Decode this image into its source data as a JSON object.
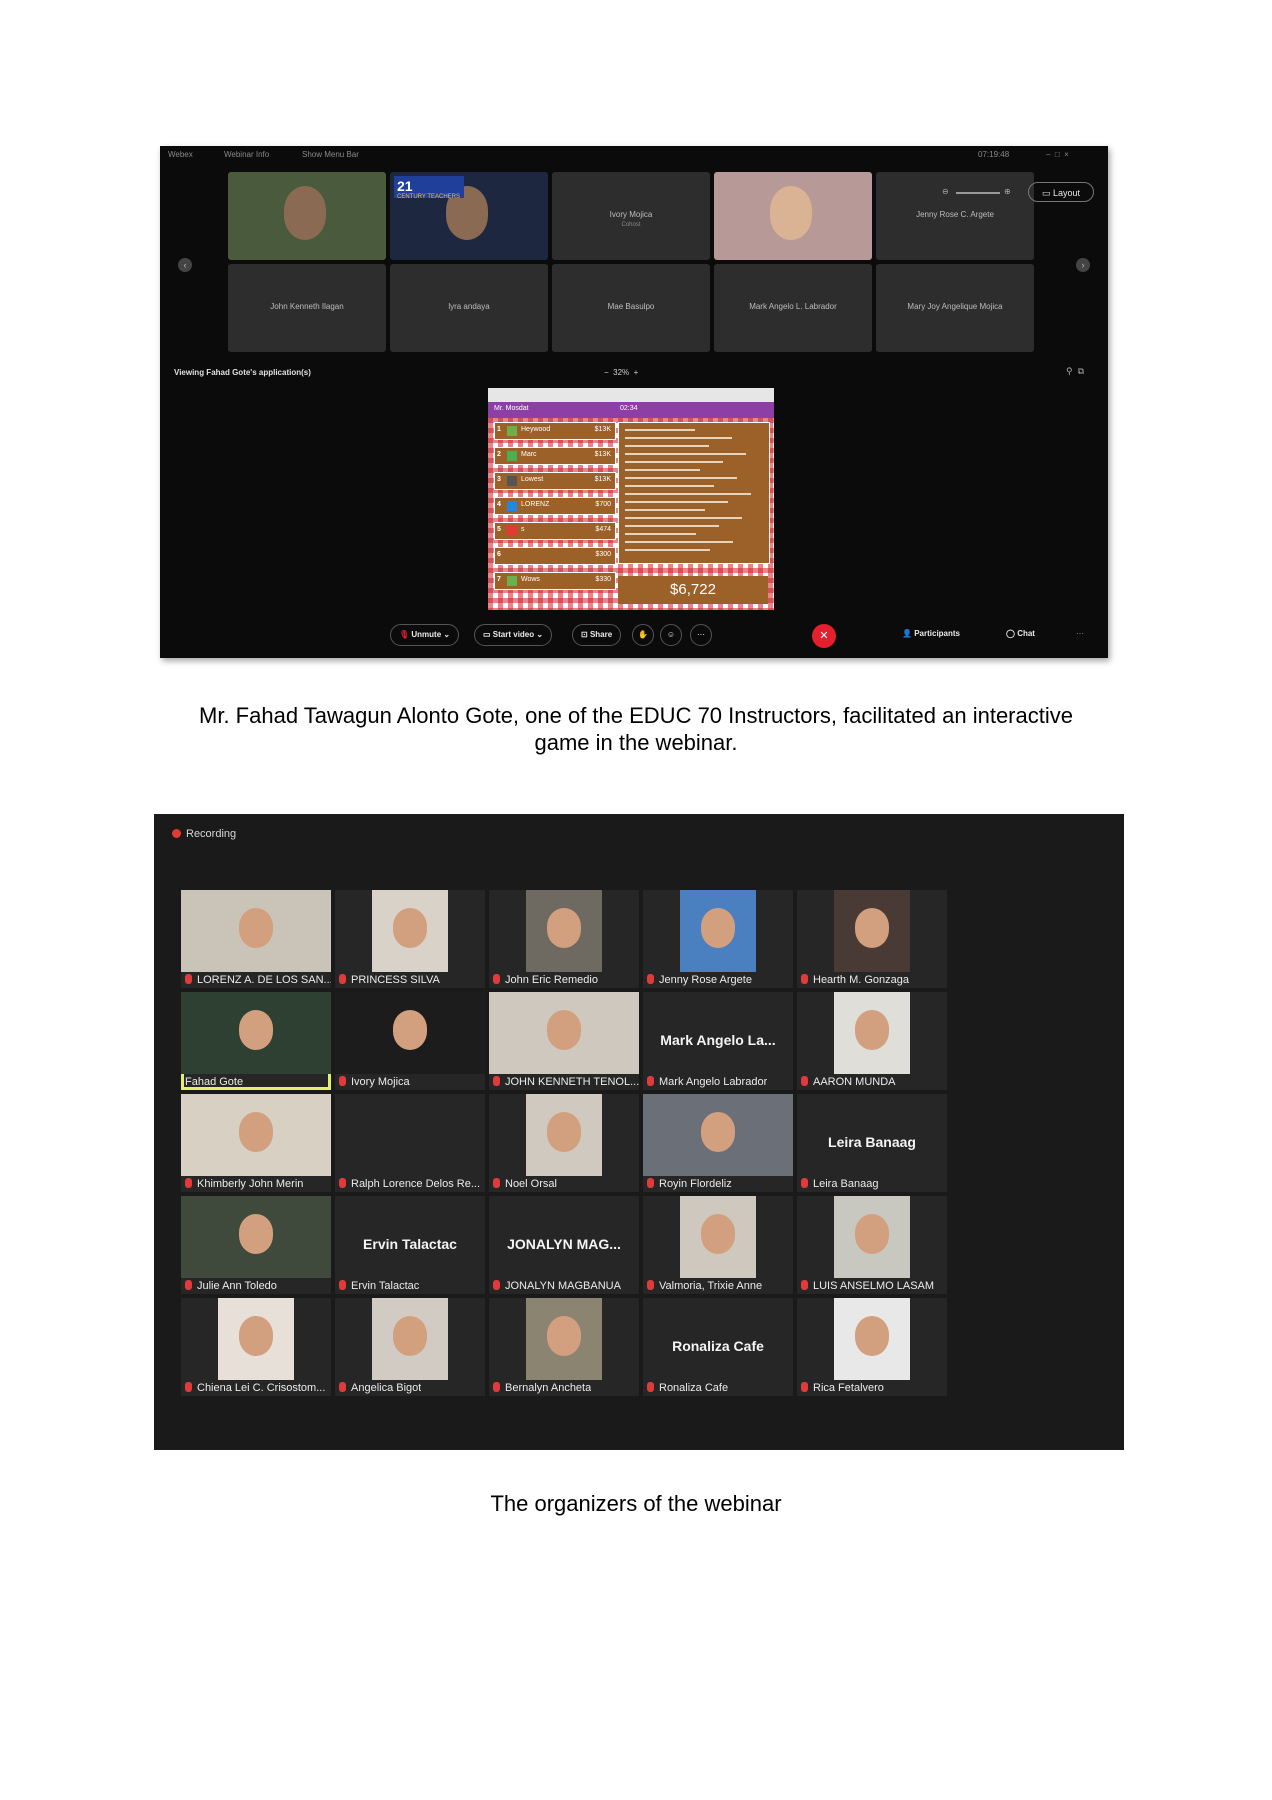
{
  "shot1": {
    "topbar": {
      "left_items": [
        "Webex",
        "Webinar Info",
        "Show Menu Bar"
      ],
      "time": "07:19:48"
    },
    "tiles": [
      {
        "kind": "video"
      },
      {
        "kind": "video-banner",
        "banner_num": "21",
        "banner_text": "CENTURY TEACHERS"
      },
      {
        "kind": "name",
        "name": "Ivory Mojica",
        "sub": "Cohost"
      },
      {
        "kind": "video"
      },
      {
        "kind": "name",
        "name": "Jenny Rose C. Argete",
        "sub": ""
      },
      {
        "kind": "name",
        "name": "John Kenneth Ilagan",
        "sub": ""
      },
      {
        "kind": "name",
        "name": "lyra andaya",
        "sub": ""
      },
      {
        "kind": "name",
        "name": "Mae Basulpo",
        "sub": ""
      },
      {
        "kind": "name",
        "name": "Mark Angelo L. Labrador",
        "sub": ""
      },
      {
        "kind": "name",
        "name": "Mary Joy Angelique Mojica",
        "sub": ""
      }
    ],
    "layout_label": "Layout",
    "viewing": "Viewing Fahad Gote's application(s)",
    "zoom_pct": "32%",
    "game": {
      "header_left": "Mr. Mosdat",
      "timer": "02:34",
      "leaderboard": [
        {
          "rank": "1",
          "name": "Heywood",
          "score": "$13K",
          "color": "#6ab04c"
        },
        {
          "rank": "2",
          "name": "Marc",
          "score": "$13K",
          "color": "#4caf50"
        },
        {
          "rank": "3",
          "name": "Lowest",
          "score": "$13K",
          "color": "#555555"
        },
        {
          "rank": "4",
          "name": "LORENZ",
          "score": "$700",
          "color": "#1e88e5"
        },
        {
          "rank": "5",
          "name": "s",
          "score": "$474",
          "color": "#e53935"
        },
        {
          "rank": "6",
          "name": "",
          "score": "$300",
          "color": "#9c6128"
        },
        {
          "rank": "7",
          "name": "Wows",
          "score": "$330",
          "color": "#6ab04c"
        }
      ],
      "total": "$6,722"
    },
    "controls": {
      "unmute": "Unmute",
      "start_video": "Start video",
      "share": "Share",
      "participants": "Participants",
      "chat": "Chat"
    }
  },
  "caption1_line1": "Mr. Fahad Tawagun Alonto Gote, one of the EDUC 70 Instructors, facilitated an interactive",
  "caption1_line2": "game in the webinar.",
  "shot2": {
    "recording": "Recording",
    "tiles": [
      {
        "label": "LORENZ A. DE LOS SAN...",
        "type": "video"
      },
      {
        "label": "PRINCESS SILVA",
        "type": "video"
      },
      {
        "label": "John Eric Remedio",
        "type": "video"
      },
      {
        "label": "Jenny Rose Argete",
        "type": "video"
      },
      {
        "label": "Hearth M. Gonzaga",
        "type": "video"
      },
      {
        "label": "Fahad Gote",
        "type": "video",
        "active": true
      },
      {
        "label": "Ivory Mojica",
        "type": "video"
      },
      {
        "label": "JOHN KENNETH TENOL...",
        "type": "video"
      },
      {
        "label": "Mark Angelo Labrador",
        "type": "name",
        "big": "Mark Angelo La..."
      },
      {
        "label": "AARON MUNDA",
        "type": "video"
      },
      {
        "label": "Khimberly John Merin",
        "type": "video"
      },
      {
        "label": "Ralph Lorence Delos Re...",
        "type": "blank"
      },
      {
        "label": "Noel Orsal",
        "type": "video"
      },
      {
        "label": "Royin Flordeliz",
        "type": "video"
      },
      {
        "label": "Leira Banaag",
        "type": "name",
        "big": "Leira Banaag"
      },
      {
        "label": "Julie Ann Toledo",
        "type": "video"
      },
      {
        "label": "Ervin Talactac",
        "type": "name",
        "big": "Ervin Talactac"
      },
      {
        "label": "JONALYN MAGBANUA",
        "type": "name",
        "big": "JONALYN MAG..."
      },
      {
        "label": "Valmoria, Trixie Anne",
        "type": "video"
      },
      {
        "label": "LUIS ANSELMO LASAM",
        "type": "video"
      },
      {
        "label": "Chiena Lei C. Crisostom...",
        "type": "video"
      },
      {
        "label": "Angelica Bigot",
        "type": "video"
      },
      {
        "label": "Bernalyn Ancheta",
        "type": "video"
      },
      {
        "label": "Ronaliza Cafe",
        "type": "name",
        "big": "Ronaliza Cafe"
      },
      {
        "label": "Rica Fetalvero",
        "type": "video"
      }
    ]
  },
  "caption2": "The organizers of the webinar"
}
